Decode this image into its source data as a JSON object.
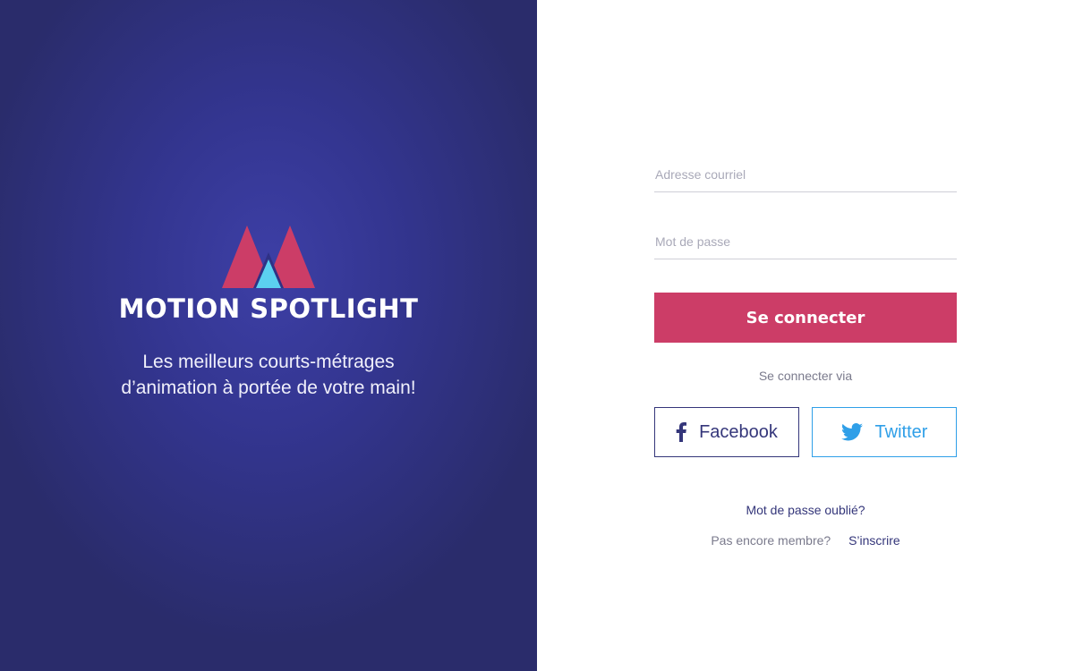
{
  "brand": {
    "name": "MOTION SPOTLIGHT",
    "tagline_line1": "Les meilleurs courts-métrages",
    "tagline_line2": "d’animation à portée de votre main!",
    "logo_colors": {
      "primary": "#cc3d67",
      "accent": "#5bd0f0"
    }
  },
  "login": {
    "email_placeholder": "Adresse courriel",
    "password_placeholder": "Mot de passe",
    "submit_label": "Se connecter",
    "via_label": "Se connecter via",
    "facebook_label": "Facebook",
    "twitter_label": "Twitter",
    "forgot_label": "Mot de passe oublié?",
    "not_member_label": "Pas encore membre?",
    "signup_label": "S’inscrire"
  },
  "colors": {
    "hero_bg": "#2f3185",
    "accent": "#cc3d67",
    "facebook": "#34367a",
    "twitter": "#2f9fe8"
  },
  "icons": {
    "facebook": "facebook-icon",
    "twitter": "twitter-icon",
    "logo": "motion-spotlight-logo"
  }
}
